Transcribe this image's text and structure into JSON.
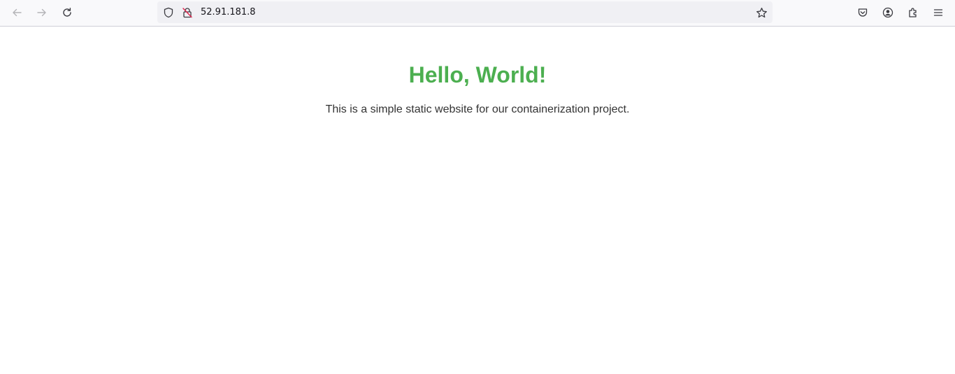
{
  "browser": {
    "url": "52.91.181.8",
    "nav_icons": [
      "back-arrow-icon",
      "forward-arrow-icon",
      "reload-icon"
    ],
    "url_icons": [
      "tracking-protection-shield-icon",
      "insecure-connection-lock-icon",
      "bookmark-star-icon"
    ],
    "toolbar_icons": [
      "pocket-icon",
      "account-icon",
      "extensions-icon",
      "menu-icon"
    ],
    "colors": {
      "toolbar_bg": "#f9f9fb",
      "urlbar_bg": "#f0f0f4",
      "insecure_lock_accent": "#e22850"
    }
  },
  "page": {
    "heading": "Hello, World!",
    "paragraph": "This is a simple static website for our containerization project.",
    "colors": {
      "heading": "#4caf50",
      "text": "#333333",
      "background": "#ffffff"
    }
  }
}
